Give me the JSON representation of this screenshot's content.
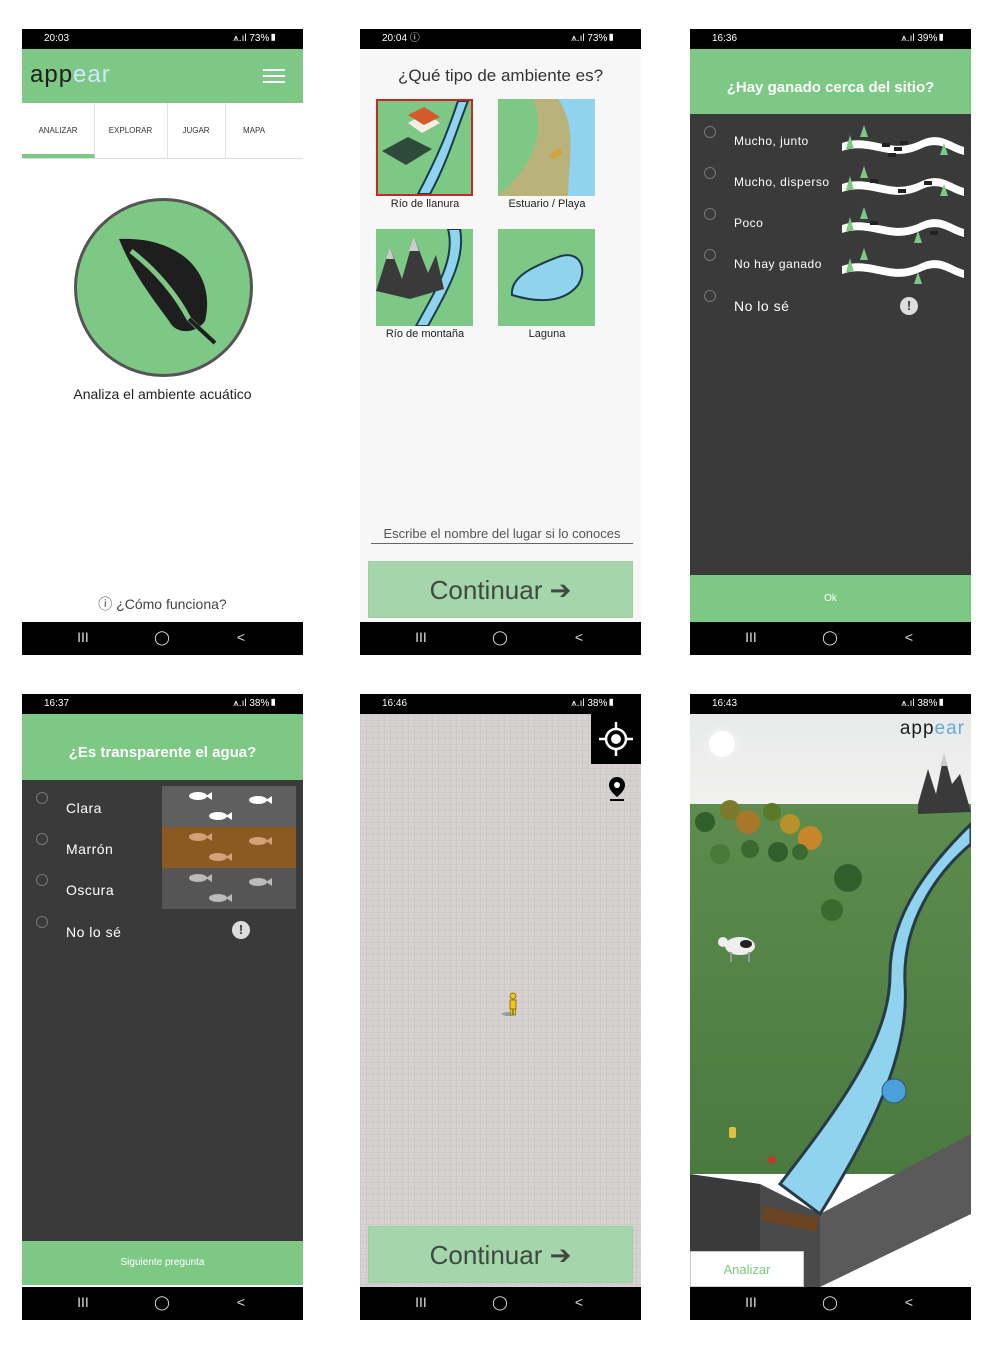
{
  "screens": {
    "analyze": {
      "time": "20:03",
      "status_right": "⩚.ıl 73%▮",
      "logo": {
        "part1": "app",
        "part2": "ear"
      },
      "tabs": [
        "ANALIZAR",
        "EXPLORAR",
        "JUGAR",
        "MAPA"
      ],
      "caption": "Analiza el ambiente acuático",
      "help_link": "ⓘ ¿Cómo funciona?"
    },
    "environment": {
      "time": "20:04 ⓘ",
      "status_right": "⩚.ıl 73%▮",
      "title": "¿Qué tipo de ambiente es?",
      "options": [
        "Río de llanura",
        "Estuario / Playa",
        "Río de montaña",
        "Laguna"
      ],
      "place_placeholder": "Escribe el nombre del lugar si lo conoces",
      "continue_label": "Continuar ➔"
    },
    "livestock": {
      "time": "16:36",
      "status_right": "⩚.ıl 39%▮",
      "question": "¿Hay ganado cerca del sitio?",
      "options": [
        "Mucho, junto",
        "Mucho, disperso",
        "Poco",
        "No hay ganado",
        "No lo sé"
      ],
      "ok_label": "Ok"
    },
    "water": {
      "time": "16:37",
      "status_right": "⩚.ıl 38%▮",
      "question": "¿Es transparente el agua?",
      "options": [
        "Clara",
        "Marrón",
        "Oscura",
        "No lo sé"
      ],
      "next_label": "Siguiente pregunta"
    },
    "map": {
      "time": "16:46",
      "status_right": "⩚.ıl 38%▮",
      "continue_label": "Continuar ➔"
    },
    "scene": {
      "time": "16:43",
      "status_right": "⩚.ıl 38%▮",
      "logo": {
        "part1": "app",
        "part2": "ear"
      },
      "analyze_label": "Analizar"
    }
  },
  "nav": {
    "recent": "III",
    "home": "◯",
    "back": "<"
  },
  "colors": {
    "brand_green": "#7dc884",
    "dark_panel": "#3a3a3a",
    "button_light_green": "#a5d6ab",
    "selected_border": "#c62828"
  },
  "icons": [
    "hamburger-menu-icon",
    "leaf-icon",
    "help-circle-icon",
    "arrow-circle-right-icon",
    "exclamation-icon",
    "gps-target-icon",
    "map-pin-icon",
    "person-icon"
  ]
}
